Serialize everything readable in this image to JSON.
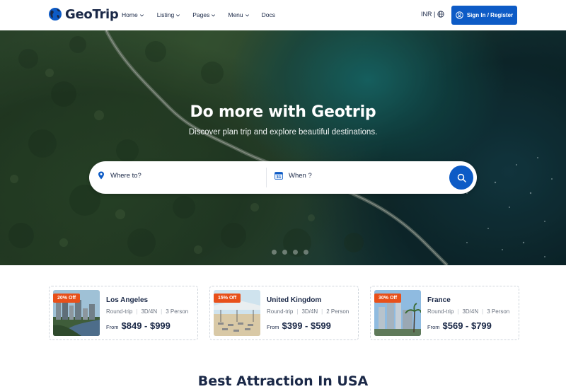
{
  "brand": {
    "name": "GeoTrip"
  },
  "nav": {
    "items": [
      {
        "label": "Home",
        "has_dropdown": true
      },
      {
        "label": "Listing",
        "has_dropdown": true
      },
      {
        "label": "Pages",
        "has_dropdown": true
      },
      {
        "label": "Menu",
        "has_dropdown": true
      },
      {
        "label": "Docs",
        "has_dropdown": false
      }
    ],
    "currency": "INR |",
    "signin_label": "Sign In / Register"
  },
  "hero": {
    "title": "Do more with Geotrip",
    "subtitle": "Discover plan trip and explore beautiful destinations.",
    "search": {
      "where_placeholder": "Where to?",
      "when_placeholder": "When ?",
      "calendar_day": "31"
    },
    "slides": 4
  },
  "deals": [
    {
      "discount": "20% Off",
      "title": "Los Angeles",
      "trip": "Round-trip",
      "duration": "3D/4N",
      "people": "3 Person",
      "from_label": "From",
      "price": "$849 - $999"
    },
    {
      "discount": "15% Off",
      "title": "United Kingdom",
      "trip": "Round-trip",
      "duration": "3D/4N",
      "people": "2 Person",
      "from_label": "From",
      "price": "$399 - $599"
    },
    {
      "discount": "30% Off",
      "title": "France",
      "trip": "Round-trip",
      "duration": "3D/4N",
      "people": "3 Person",
      "from_label": "From",
      "price": "$569 - $799"
    }
  ],
  "section": {
    "title": "Best Attraction In USA"
  },
  "colors": {
    "primary": "#0d5bc6",
    "dark": "#1a2847",
    "badge": "#e8501a"
  },
  "icons": [
    "globe-icon",
    "map-pin-icon",
    "calendar-icon",
    "search-icon",
    "user-circle-icon",
    "chevron-down-icon"
  ]
}
